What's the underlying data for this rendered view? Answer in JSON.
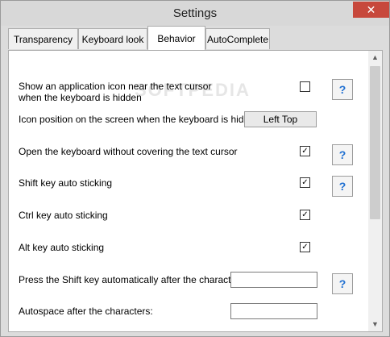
{
  "window": {
    "title": "Settings",
    "close_glyph": "✕"
  },
  "tabs": [
    {
      "label": "Transparency",
      "active": false
    },
    {
      "label": "Keyboard look",
      "active": false
    },
    {
      "label": "Behavior",
      "active": true
    },
    {
      "label": "AutoComplete",
      "active": false
    }
  ],
  "watermark": "SOFTPEDIA",
  "settings": {
    "show_icon": {
      "label_line1": "Show an application icon near the text cursor",
      "label_line2": "when the keyboard is hidden",
      "checked": false,
      "help": "?"
    },
    "icon_position": {
      "label": "Icon position on the screen when the keyboard is hidden",
      "button_label": "Left Top"
    },
    "open_without_covering": {
      "label": "Open the keyboard without covering the text cursor",
      "checked": true,
      "help": "?"
    },
    "shift_sticking": {
      "label": "Shift key auto sticking",
      "checked": true,
      "help": "?"
    },
    "ctrl_sticking": {
      "label": "Ctrl key auto sticking",
      "checked": true
    },
    "alt_sticking": {
      "label": "Alt key auto sticking",
      "checked": true
    },
    "shift_after_chars": {
      "label": "Press the Shift key automatically after the characters:",
      "value": "",
      "help": "?"
    },
    "autospace_after_chars": {
      "label": "Autospace after the characters:",
      "value": ""
    }
  },
  "scrollbar": {
    "up_glyph": "▲",
    "down_glyph": "▼"
  },
  "colors": {
    "close_button": "#c7483c",
    "help_icon": "#1f6fd1",
    "window_bg": "#dcdcdc"
  }
}
